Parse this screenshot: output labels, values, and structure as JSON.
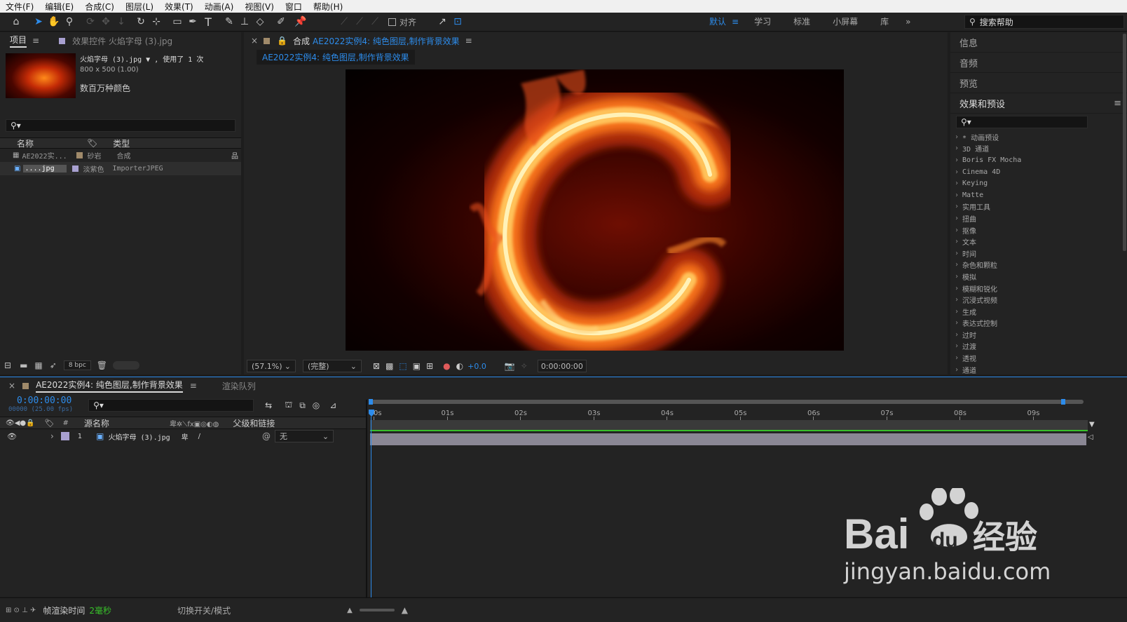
{
  "menubar": {
    "items": [
      "文件(F)",
      "编辑(E)",
      "合成(C)",
      "图层(L)",
      "效果(T)",
      "动画(A)",
      "视图(V)",
      "窗口",
      "帮助(H)"
    ]
  },
  "toolbar": {
    "snap_label": "对齐",
    "workspaces": [
      "默认",
      "学习",
      "标准",
      "小屏幕",
      "库"
    ],
    "active_workspace": "默认",
    "help_search_placeholder": "搜索帮助"
  },
  "project_panel": {
    "tab_project": "项目",
    "tab_effects": "效果控件 火焰字母 (3).jpg",
    "selected_name": "火焰字母 (3).jpg ▼ , 使用了 1 次",
    "selected_dims": "800 x 500 (1.00)",
    "selected_color": "数百万种颜色",
    "columns": {
      "name": "名称",
      "type": "类型"
    },
    "items": [
      {
        "name": "AE2022实...",
        "label": "砂岩",
        "type": "合成",
        "label_color": "#a08a6a"
      },
      {
        "name": "....jpg",
        "label": "淡紫色",
        "type": "ImporterJPEG",
        "label_color": "#a8a0d0"
      }
    ],
    "bpc": "8 bpc"
  },
  "comp_panel": {
    "header_prefix": "合成",
    "comp_name": "AE2022实例4: 纯色图层,制作背景效果",
    "breadcrumb": "AE2022实例4: 纯色图层,制作背景效果",
    "zoom": "(57.1%)",
    "resolution": "(完整)",
    "exposure": "+0.0",
    "timecode": "0:00:00:00"
  },
  "right_panel": {
    "sections": [
      "信息",
      "音频",
      "预览"
    ],
    "effects_title": "效果和预设",
    "effects": [
      "* 动画预设",
      "3D 通道",
      "Boris FX Mocha",
      "Cinema 4D",
      "Keying",
      "Matte",
      "实用工具",
      "扭曲",
      "抠像",
      "文本",
      "时间",
      "杂色和颗粒",
      "模拟",
      "模糊和锐化",
      "沉浸式视频",
      "生成",
      "表达式控制",
      "过时",
      "过渡",
      "透视",
      "通道"
    ]
  },
  "timeline": {
    "comp_tab": "AE2022实例4: 纯色图层,制作背景效果",
    "render_queue_tab": "渲染队列",
    "timecode": "0:00:00:00",
    "frame_info": "00000 (25.00 fps)",
    "col_hash": "#",
    "col_source": "源名称",
    "col_parent": "父级和链接",
    "layer": {
      "index": "1",
      "name": "火焰字母 (3).jpg",
      "parent": "无",
      "label_color": "#a8a0d0"
    },
    "ruler": [
      "0s",
      "01s",
      "02s",
      "03s",
      "04s",
      "05s",
      "06s",
      "07s",
      "08s",
      "09s"
    ]
  },
  "statusbar": {
    "render_label": "帧渲染时间",
    "render_value": "2毫秒",
    "toggle_label": "切换开关/模式"
  },
  "watermark": {
    "brand": "Baidu经验",
    "url": "jingyan.baidu.com"
  }
}
